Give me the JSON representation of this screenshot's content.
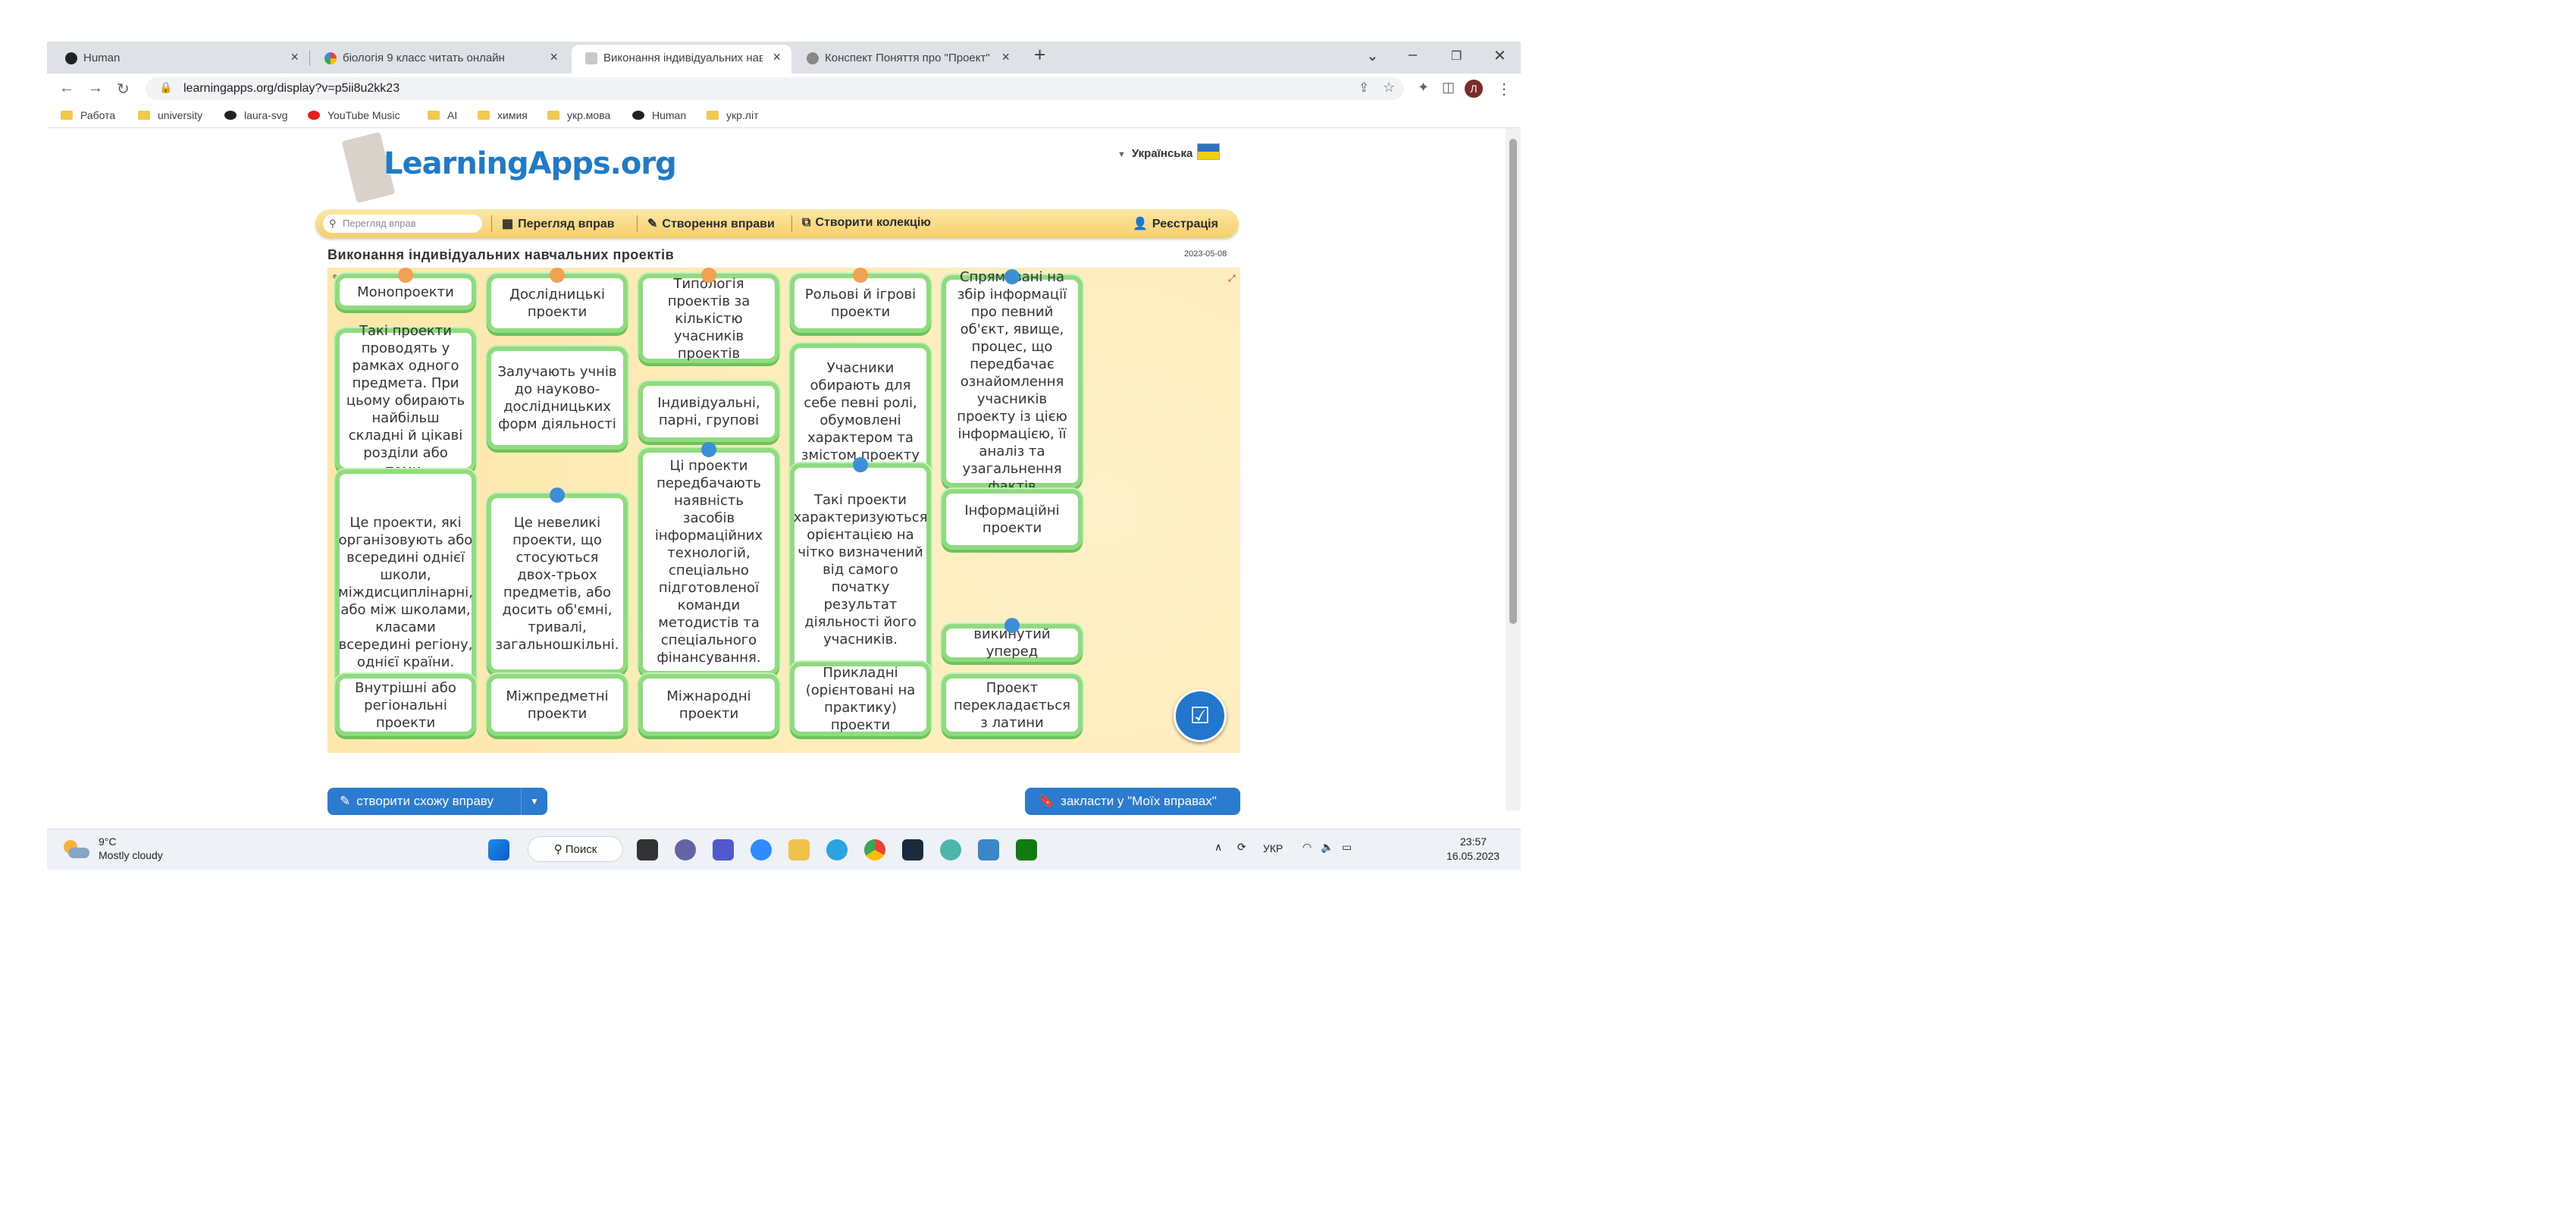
{
  "browser": {
    "tabs": [
      {
        "label": "Human",
        "active": false
      },
      {
        "label": "біологія 9 класс читать онлайн",
        "active": false
      },
      {
        "label": "Виконання індивідуальних навчальних",
        "active": true
      },
      {
        "label": "Конспект Поняття про \"Проект\"",
        "active": false
      }
    ],
    "url": "learningapps.org/display?v=p5ii8u2kk23",
    "bookmarks": [
      "Работа",
      "university",
      "laura-svg",
      "YouTube Music",
      "AI",
      "химия",
      "укр.мова",
      "Human",
      "укр.літ"
    ],
    "profile_initial": "Л"
  },
  "site": {
    "logo": "LearningApps.org",
    "language": "Українська",
    "search_placeholder": "Перегляд вправ",
    "menu": {
      "browse": "Перегляд вправ",
      "create": "Створення вправи",
      "collection": "Створити колекцію",
      "register": "Реєстрація"
    },
    "app_title": "Виконання індивідуальних навчальних проектів",
    "app_date": "2023-05-08"
  },
  "board": {
    "cards": [
      {
        "text": "Монопроекти",
        "pin": "orange"
      },
      {
        "text": "Такі проекти проводять у рамках одного предмета. При цьому обирають найбільш складні й цікаві розділи або теми.",
        "pin": ""
      },
      {
        "text": "Це проекти, які організовують або всередині однієї школи, міждисциплінарні, або між школами, класами всередині регіону, однієї країни.",
        "pin": ""
      },
      {
        "text": "Внутрішні або регіональні проекти",
        "pin": ""
      },
      {
        "text": "Дослідницькі проекти",
        "pin": "orange"
      },
      {
        "text": "Залучають учнів до науково-дослідницьких форм діяльності",
        "pin": ""
      },
      {
        "text": "Це невеликі проекти, що стосуються двох-трьох предметів, або досить об'ємні, тривалі, загальношкільні.",
        "pin": "blue"
      },
      {
        "text": "Міжпредметні проекти",
        "pin": ""
      },
      {
        "text": "Типологія проектів за кількістю учасників проектів",
        "pin": "orange"
      },
      {
        "text": "Індивідуальні, парні, групові",
        "pin": ""
      },
      {
        "text": "Ці проекти передбачають наявність засобів інформаційних технологій, спеціально підготовленої команди методистів та спеціального фінансування.",
        "pin": "blue"
      },
      {
        "text": "Міжнародні проекти",
        "pin": ""
      },
      {
        "text": "Рольові й ігрові проекти",
        "pin": "orange"
      },
      {
        "text": "Учасники обирають для себе певні ролі, обумовлені характером та змістом проекту",
        "pin": ""
      },
      {
        "text": "Такі проекти характеризуються орієнтацією на чітко визначений від самого початку результат діяльності його учасників.",
        "pin": "blue"
      },
      {
        "text": "Прикладні (орієнтовані на практику) проекти",
        "pin": ""
      },
      {
        "text": "Спрямовані на збір інформації про певний об'єкт, явище, процес, що передбачає ознайомлення учасників проекту із цією інформацією, її аналіз та узагальнення фактів",
        "pin": "blue"
      },
      {
        "text": "Інформаційні проекти",
        "pin": ""
      },
      {
        "text": "викинутий уперед",
        "pin": "blue"
      },
      {
        "text": "Проект перекладається з латини",
        "pin": ""
      }
    ]
  },
  "bottom": {
    "create_similar": "створити схожу вправу",
    "bookmark": "закласти у \"Моїх вправах\""
  },
  "taskbar": {
    "temperature": "9°C",
    "weather": "Mostly cloudy",
    "search": "Поиск",
    "lang": "УКР",
    "time": "23:57",
    "date": "16.05.2023"
  },
  "colors": {
    "accent": "#2b7bd1",
    "card_border": "#8fdc7e",
    "board_bg": "#fde7a9",
    "pin_orange": "#f2a054",
    "pin_blue": "#3c8fd6"
  }
}
